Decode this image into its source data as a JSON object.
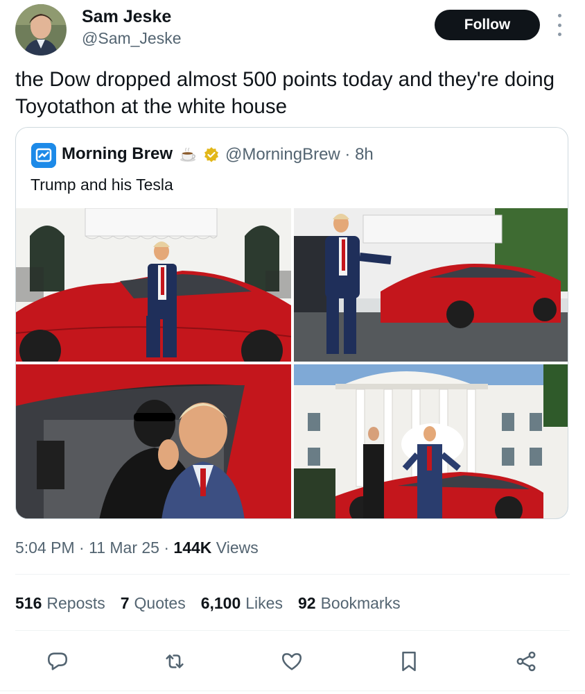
{
  "author": {
    "name": "Sam Jeske",
    "handle": "@Sam_Jeske",
    "avatar_icon": "profile-photo"
  },
  "follow_label": "Follow",
  "tweet_text": "the Dow dropped almost 500 points today and they're doing Toyotathon at the white house",
  "quote": {
    "name": "Morning Brew",
    "handle": "@MorningBrew",
    "time": "· 8h",
    "text": "Trump and his Tesla",
    "emoji_icon": "coffee-cup",
    "verified_color": "#e2b719",
    "avatar_color": "#1d8ae8"
  },
  "meta": {
    "time": "5:04 PM",
    "sep1": " · ",
    "date": "11 Mar 25",
    "sep2": " · ",
    "views_count": "144K",
    "views_label": "Views"
  },
  "stats": {
    "reposts_count": "516",
    "reposts_label": "Reposts",
    "quotes_count": "7",
    "quotes_label": "Quotes",
    "likes_count": "6,100",
    "likes_label": "Likes",
    "bookmarks_count": "92",
    "bookmarks_label": "Bookmarks"
  },
  "actions": [
    "reply-icon",
    "repost-icon",
    "like-icon",
    "bookmark-icon",
    "share-icon"
  ],
  "colors": {
    "text": "#0f1419",
    "secondary": "#536471",
    "border": "#cfd9de",
    "car_red": "#c4161c"
  }
}
